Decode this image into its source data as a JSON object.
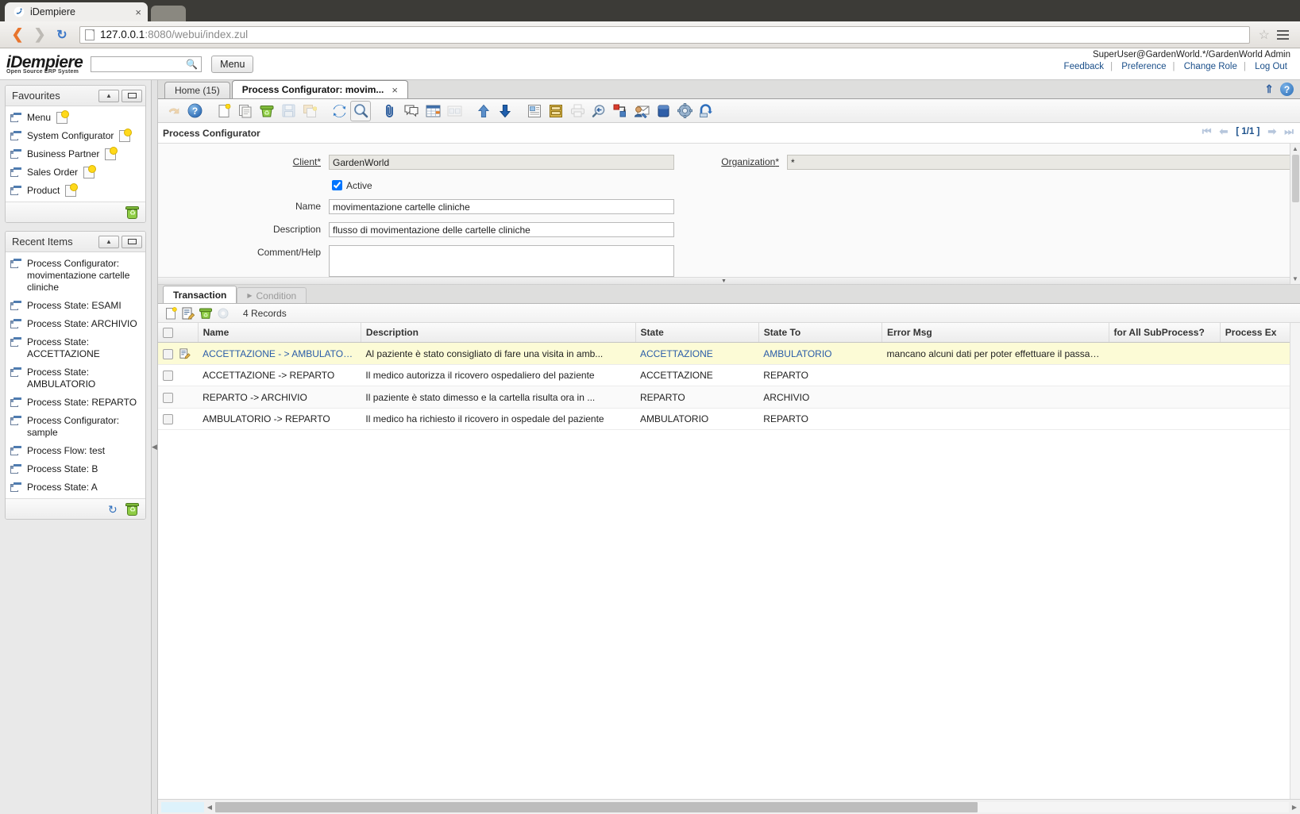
{
  "browser": {
    "tab_title": "iDempiere",
    "tab_close": "×",
    "url_host": "127.0.0.1",
    "url_rest": ":8080/webui/index.zul"
  },
  "app_header": {
    "logo_main": "iDempiere",
    "logo_sub": "Open Source  ERP System",
    "search_placeholder": "",
    "search_value": "",
    "menu_button": "Menu",
    "user_info": "SuperUser@GardenWorld.*/GardenWorld Admin",
    "links": [
      "Feedback",
      "Preference",
      "Change Role",
      "Log Out"
    ]
  },
  "sidebar": {
    "favourites": {
      "title": "Favourites",
      "items": [
        {
          "label": "Menu"
        },
        {
          "label": "System Configurator"
        },
        {
          "label": "Business Partner"
        },
        {
          "label": "Sales Order"
        },
        {
          "label": "Product"
        }
      ]
    },
    "recent_items": {
      "title": "Recent Items",
      "items": [
        {
          "label": "Process Configurator: movimentazione cartelle cliniche"
        },
        {
          "label": "Process State: ESAMI"
        },
        {
          "label": "Process State: ARCHIVIO"
        },
        {
          "label": "Process State: ACCETTAZIONE"
        },
        {
          "label": "Process State: AMBULATORIO"
        },
        {
          "label": "Process State: REPARTO"
        },
        {
          "label": "Process Configurator: sample"
        },
        {
          "label": "Process Flow: test"
        },
        {
          "label": "Process State: B"
        },
        {
          "label": "Process State: A"
        }
      ]
    }
  },
  "window_tabs": [
    {
      "label": "Home (15)",
      "active": false,
      "closable": false
    },
    {
      "label": "Process Configurator: movim...",
      "active": true,
      "closable": true,
      "close": "×"
    }
  ],
  "form": {
    "title": "Process Configurator",
    "pager": {
      "page": "[ 1/1 ]"
    },
    "fields": {
      "client_label": "Client",
      "client_value": "GardenWorld",
      "organization_label": "Organization",
      "organization_value": "*",
      "active_label": "Active",
      "active_checked": true,
      "name_label": "Name",
      "name_value": "movimentazione cartelle cliniche",
      "description_label": "Description",
      "description_value": "flusso di movimentazione delle cartelle cliniche",
      "comment_label": "Comment/Help",
      "comment_value": ""
    }
  },
  "grid": {
    "tabs": [
      {
        "label": "Transaction",
        "active": true
      },
      {
        "label": "Condition",
        "active": false
      }
    ],
    "record_count": "4 Records",
    "columns": [
      "Name",
      "Description",
      "State",
      "State To",
      "Error Msg",
      "for All SubProcess?",
      "Process Ex"
    ],
    "rows": [
      {
        "name": "ACCETTAZIONE - > AMBULATORIO",
        "description": "Al paziente è stato consigliato di fare una visita in amb...",
        "state": "ACCETTAZIONE",
        "state_to": "AMBULATORIO",
        "error_msg": "mancano alcuni dati per poter effettuare il passaggio in ...",
        "for_all_subprocess": "",
        "process_ex": "",
        "selected": true
      },
      {
        "name": "ACCETTAZIONE -> REPARTO",
        "description": "Il medico autorizza il ricovero ospedaliero del paziente",
        "state": "ACCETTAZIONE",
        "state_to": "REPARTO",
        "error_msg": "",
        "for_all_subprocess": "",
        "process_ex": "",
        "selected": false
      },
      {
        "name": "REPARTO -> ARCHIVIO",
        "description": "Il paziente è stato dimesso e la cartella risulta ora in ...",
        "state": "REPARTO",
        "state_to": "ARCHIVIO",
        "error_msg": "",
        "for_all_subprocess": "",
        "process_ex": "",
        "selected": false
      },
      {
        "name": "AMBULATORIO -> REPARTO",
        "description": "Il medico ha richiesto il ricovero in ospedale del paziente",
        "state": "AMBULATORIO",
        "state_to": "REPARTO",
        "error_msg": "",
        "for_all_subprocess": "",
        "process_ex": "",
        "selected": false
      }
    ]
  },
  "colors": {
    "accent_blue": "#2a5ca8",
    "selected_row": "#fcfbd6",
    "link": "#1a4f8a",
    "orange": "#e07b20"
  }
}
